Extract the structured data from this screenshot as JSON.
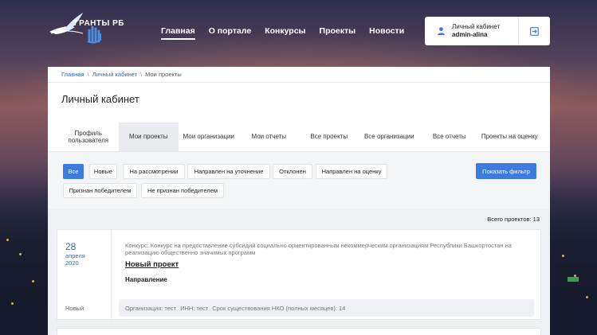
{
  "header": {
    "logo_text": "ГРАНТЫ РБ",
    "nav": [
      {
        "label": "Главная",
        "active": true
      },
      {
        "label": "О портале",
        "active": false
      },
      {
        "label": "Конкурсы",
        "active": false
      },
      {
        "label": "Проекты",
        "active": false
      },
      {
        "label": "Новости",
        "active": false
      }
    ],
    "account": {
      "label": "Личный кабинет",
      "login": "admin-alina",
      "user_icon": "user-icon",
      "logout_icon": "logout-icon"
    }
  },
  "breadcrumb": {
    "items": [
      "Главная",
      "Личный кабинет",
      "Мои проекты"
    ],
    "separator": "\\"
  },
  "page_title": "Личный кабинет",
  "tabs": [
    {
      "label": "Профиль пользователя",
      "active": false
    },
    {
      "label": "Мои проекты",
      "active": true
    },
    {
      "label": "Мои организации",
      "active": false
    },
    {
      "label": "Мои отчеты",
      "active": false
    },
    {
      "label": "Все проекты",
      "active": false
    },
    {
      "label": "Все организации",
      "active": false
    },
    {
      "label": "Все отчеты",
      "active": false
    },
    {
      "label": "Проекты на оценку",
      "active": false
    }
  ],
  "filters": {
    "buttons": [
      {
        "label": "Все",
        "active": true
      },
      {
        "label": "Новые",
        "active": false
      },
      {
        "label": "На рассмотрении",
        "active": false
      },
      {
        "label": "Направлен на уточнение",
        "active": false
      },
      {
        "label": "Отклонен",
        "active": false
      },
      {
        "label": "Направлен на оценку",
        "active": false
      },
      {
        "label": "Признан победителем",
        "active": false
      },
      {
        "label": "Не признан победителем",
        "active": false
      }
    ],
    "show_filter_label": "Показать фильтр"
  },
  "list": {
    "total_label": "Всего проектов:",
    "total_count": "13",
    "projects": [
      {
        "day": "28",
        "month": "апреля",
        "year": "2020",
        "status": "Новый",
        "contest": "Конкурс: Конкурс на предоставление субсидий социально ориентированным некоммерческим организациям Республики Башкортостан на реализацию общественно значимых программ",
        "title": "Новый проект",
        "direction_label": "Направление",
        "organization": "Организация: тест",
        "inn": "ИНН: тест",
        "term": "Срок существования НКО (полных месяцев): 14"
      }
    ]
  },
  "colors": {
    "accent": "#3d7be0",
    "link": "#2b6cb0",
    "active_tab_bg": "#e9ebee"
  }
}
